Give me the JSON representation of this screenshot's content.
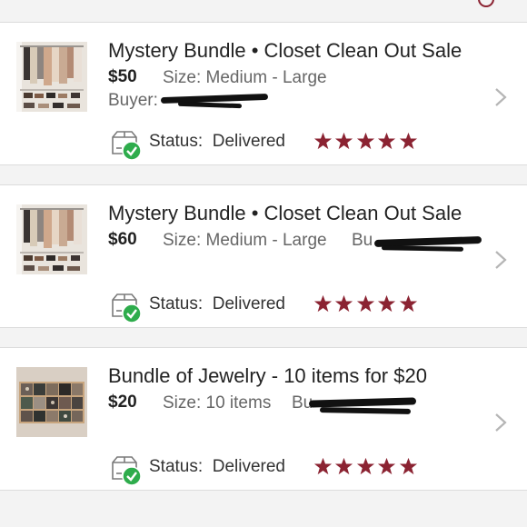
{
  "colors": {
    "accent": "#8b2332",
    "check": "#2eac4c",
    "chevron": "#b5b5b5"
  },
  "orders": [
    {
      "title": "Mystery Bundle • Closet Clean Out Sale",
      "price": "$50",
      "size": "Size: Medium - Large",
      "buyer_label": "Buyer:",
      "status_label": "Status:",
      "status_value": "Delivered",
      "rating": 5,
      "thumbnail": "closet-rack-photo"
    },
    {
      "title": "Mystery Bundle • Closet Clean Out Sale",
      "price": "$60",
      "size": "Size: Medium - Large",
      "buyer_label": "Bu",
      "status_label": "Status:",
      "status_value": "Delivered",
      "rating": 5,
      "thumbnail": "closet-rack-photo"
    },
    {
      "title": "Bundle of Jewelry - 10 items for $20",
      "price": "$20",
      "size": "Size: 10 items",
      "buyer_label": "Bu",
      "status_label": "Status:",
      "status_value": "Delivered",
      "rating": 5,
      "thumbnail": "jewelry-organizer-photo"
    }
  ]
}
